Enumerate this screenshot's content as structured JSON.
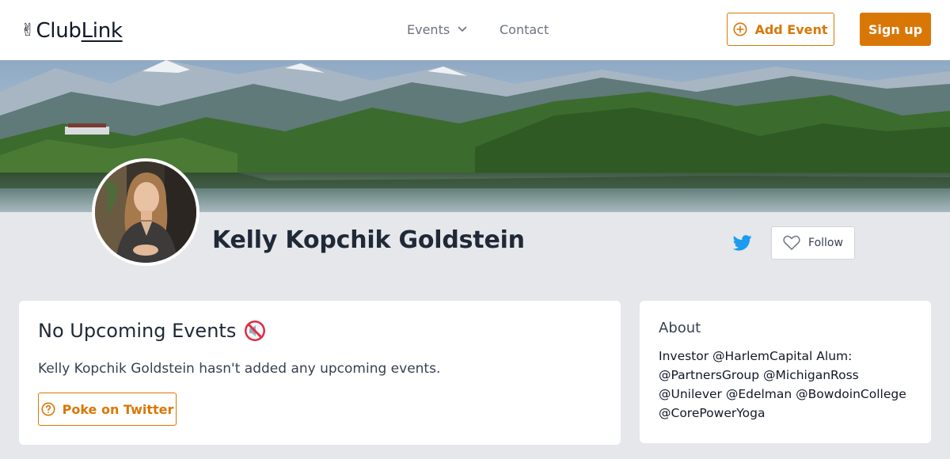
{
  "header": {
    "logo_club": "Club",
    "logo_link": "Link",
    "logo_emoji": "✌",
    "nav": {
      "events_label": "Events",
      "contact_label": "Contact"
    },
    "add_event_label": "Add Event",
    "sign_up_label": "Sign up"
  },
  "profile": {
    "name": "Kelly Kopchik Goldstein",
    "follow_label": "Follow"
  },
  "events_card": {
    "title": "No Upcoming Events",
    "title_emoji": "🔇",
    "message": "Kelly Kopchik Goldstein hasn't added any upcoming events.",
    "poke_label": "Poke on Twitter"
  },
  "about_card": {
    "title": "About",
    "bio": "Investor @HarlemCapital Alum: @PartnersGroup @MichiganRoss @Unilever @Edelman @BowdoinCollege @CorePowerYoga"
  },
  "colors": {
    "accent": "#d97706",
    "page_bg": "#e5e7eb",
    "twitter": "#1d9bf0"
  },
  "icons": [
    "plus-circle-icon",
    "chevron-down-icon",
    "twitter-icon",
    "heart-icon",
    "question-circle-icon",
    "muted-speaker-icon"
  ]
}
